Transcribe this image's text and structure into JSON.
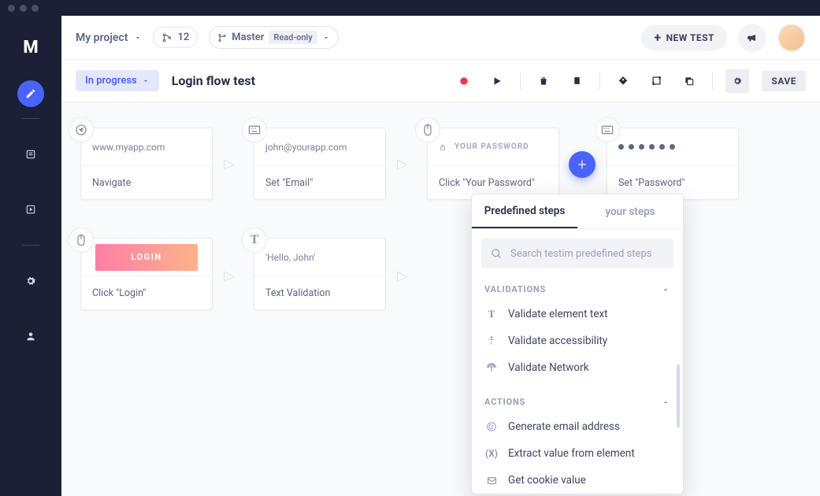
{
  "project": {
    "name": "My project",
    "merge_count": "12",
    "branch": "Master",
    "branch_status": "Read-only"
  },
  "header": {
    "new_test_label": "NEW TEST"
  },
  "toolbar": {
    "status": "In progress",
    "test_title": "Login flow test",
    "save_label": "SAVE"
  },
  "steps": [
    {
      "preview": "www.myapp.com",
      "label": "Navigate"
    },
    {
      "preview": "john@yourapp.com",
      "label": "Set \"Email\""
    },
    {
      "preview_type": "password-field",
      "preview_placeholder": "YOUR PASSWORD",
      "label": "Click \"Your Password\""
    },
    {
      "preview_type": "dots",
      "label": "Set \"Password\""
    },
    {
      "preview_type": "login-button",
      "preview_text": "LOGIN",
      "label": "Click \"Login\""
    },
    {
      "preview": "'Hello, John'",
      "label": "Text Validation"
    }
  ],
  "popover": {
    "tabs": {
      "predefined": "Predefined steps",
      "yours": "your steps"
    },
    "search_placeholder": "Search testim predefined steps",
    "sections": {
      "validations": {
        "title": "VALIDATIONS",
        "items": [
          "Validate element text",
          "Validate accessibility",
          "Validate Network"
        ]
      },
      "actions": {
        "title": "ACTIONS",
        "items": [
          "Generate email address",
          "Extract value from element",
          "Get cookie value"
        ]
      }
    }
  }
}
